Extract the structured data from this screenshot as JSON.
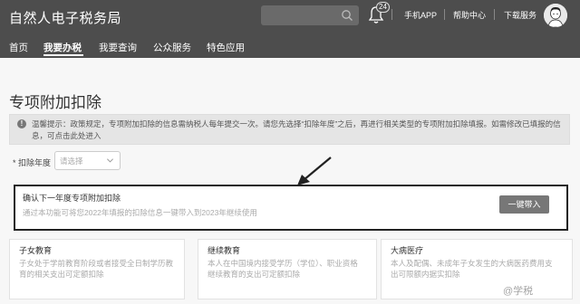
{
  "header": {
    "app_title": "自然人电子税务局",
    "notification_count": "24",
    "links": {
      "mobile_app": "手机APP",
      "help_center": "帮助中心",
      "download_service": "下载服务"
    }
  },
  "nav": {
    "items": [
      {
        "label": "首页"
      },
      {
        "label": "我要办税"
      },
      {
        "label": "我要查询"
      },
      {
        "label": "公众服务"
      },
      {
        "label": "特色应用"
      }
    ],
    "active_index": 1
  },
  "page": {
    "title": "专项附加扣除"
  },
  "notice": {
    "icon": "info-icon",
    "text": "温馨提示：政策规定，专项附加扣除的信息需纳税人每年提交一次。请您先选择“扣除年度”之后，再进行相关类型的专项附加扣除填报。如需修改已填报的信息，可点击",
    "link_text": "此处",
    "text_after": "进入"
  },
  "year_selector": {
    "required_mark": "*",
    "label": "扣除年度",
    "placeholder": "请选择"
  },
  "confirm": {
    "title": "确认下一年度专项附加扣除",
    "description": "通过本功能可将您2022年填报的扣除信息一键带入到2023年继续使用",
    "button_label": "一键带入"
  },
  "cards": [
    {
      "title": "子女教育",
      "description": "子女处于学前教育阶段或者接受全日制学历教育的相关支出可定额扣除"
    },
    {
      "title": "继续教育",
      "description": "本人在中国境内接受学历（学位）、职业资格继续教育的支出可定额扣除"
    },
    {
      "title": "大病医疗",
      "description": "本人及配偶、未成年子女发生的大病医药费用支出可限额内据实扣除"
    }
  ],
  "watermark": "@学税",
  "colors": {
    "header_bg": "#4d4d4d",
    "button_bg": "#777777",
    "page_bg": "#f7f7f7"
  }
}
